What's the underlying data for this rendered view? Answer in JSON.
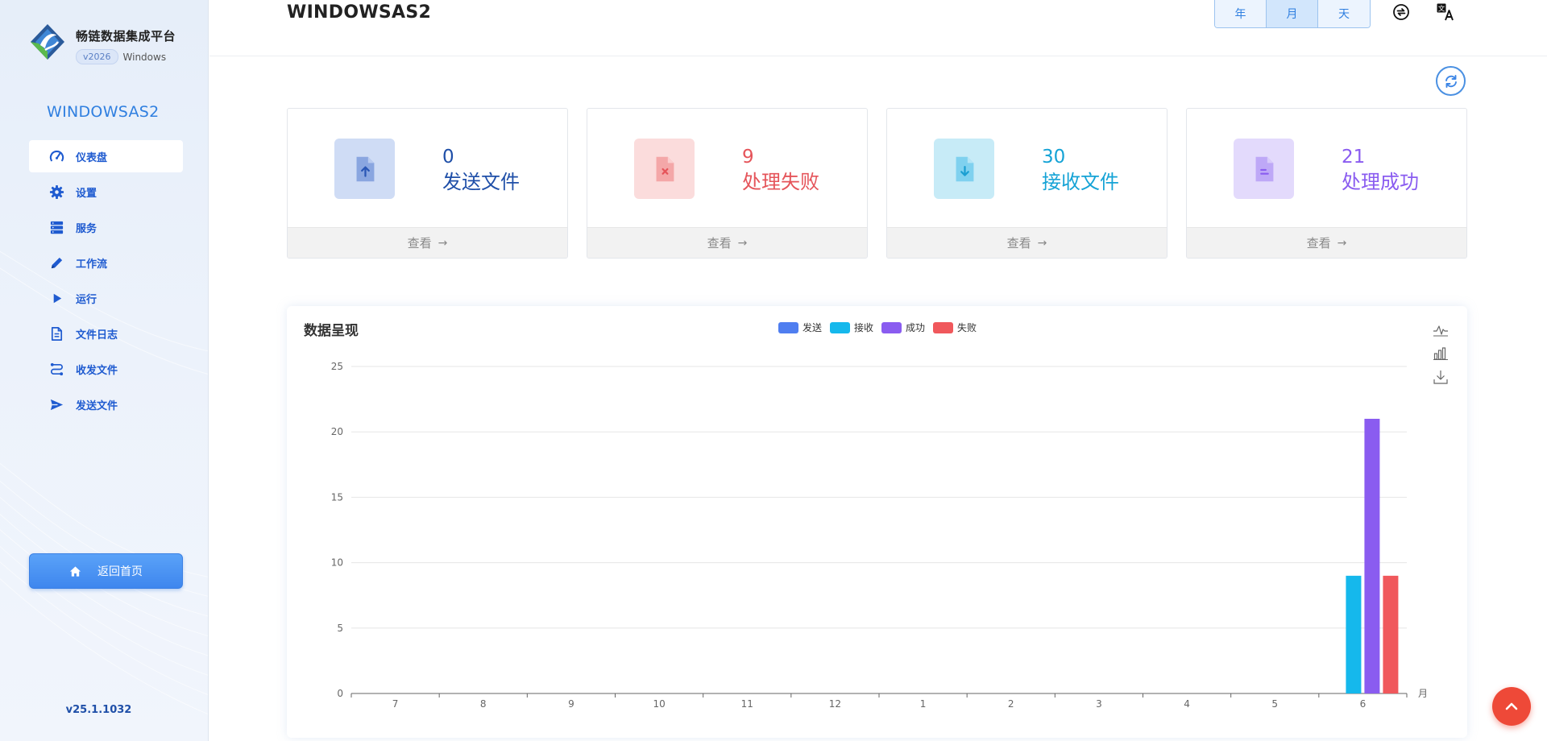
{
  "brand": {
    "name": "畅链数据集成平台",
    "version": "v2026",
    "os": "Windows"
  },
  "sidebar": {
    "title": "WINDOWSAS2",
    "items": [
      {
        "label": "仪表盘",
        "icon": "dashboard-icon",
        "active": true
      },
      {
        "label": "设置",
        "icon": "gear-icon"
      },
      {
        "label": "服务",
        "icon": "server-icon"
      },
      {
        "label": "工作流",
        "icon": "pencil-icon"
      },
      {
        "label": "运行",
        "icon": "play-icon"
      },
      {
        "label": "文件日志",
        "icon": "file-text-icon"
      },
      {
        "label": "收发文件",
        "icon": "route-icon"
      },
      {
        "label": "发送文件",
        "icon": "send-icon"
      }
    ],
    "home_button": "返回首页",
    "version": "v25.1.1032"
  },
  "header": {
    "title": "WINDOWSAS2",
    "periods": [
      "年",
      "月",
      "天"
    ],
    "active_period": "月",
    "icons": [
      "exchange-icon",
      "translate-icon"
    ]
  },
  "stats": [
    {
      "value": "0",
      "label": "发送文件",
      "link": "查看",
      "icon": "file-upload-icon",
      "color": "#1f4fa8",
      "bg": "#cfdcf5",
      "fg": "#8aa6e0",
      "mark": "#2a56b5"
    },
    {
      "value": "9",
      "label": "处理失败",
      "link": "查看",
      "icon": "file-error-icon",
      "color": "#e5545a",
      "bg": "#fbdcdc",
      "fg": "#f4a7a8",
      "mark": "#e5545a"
    },
    {
      "value": "30",
      "label": "接收文件",
      "link": "查看",
      "icon": "file-download-icon",
      "color": "#15a3d6",
      "bg": "#c7ebf7",
      "fg": "#7fd1ef",
      "mark": "#1b9fd2"
    },
    {
      "value": "21",
      "label": "处理成功",
      "link": "查看",
      "icon": "file-done-icon",
      "color": "#8a5cf0",
      "bg": "#e3dafc",
      "fg": "#bea8f7",
      "mark": "#8a5cf0"
    }
  ],
  "chart": {
    "title": "数据呈现",
    "tools": [
      "line-chart-icon",
      "bar-chart-icon",
      "download-icon"
    ]
  },
  "chart_data": {
    "type": "bar",
    "title": "数据呈现",
    "categories": [
      "7",
      "8",
      "9",
      "10",
      "11",
      "12",
      "1",
      "2",
      "3",
      "4",
      "5",
      "6"
    ],
    "xlabel": "月",
    "ylabel": "",
    "ylim": [
      0,
      25
    ],
    "yticks": [
      0,
      5,
      10,
      15,
      20,
      25
    ],
    "grid": true,
    "legend_position": "top-center",
    "series": [
      {
        "name": "发送",
        "color": "#4f7ef0",
        "values": [
          0,
          0,
          0,
          0,
          0,
          0,
          0,
          0,
          0,
          0,
          0,
          0
        ]
      },
      {
        "name": "接收",
        "color": "#15b8ec",
        "values": [
          0,
          0,
          0,
          0,
          0,
          0,
          0,
          0,
          0,
          0,
          0,
          9
        ]
      },
      {
        "name": "成功",
        "color": "#8a5cf0",
        "values": [
          0,
          0,
          0,
          0,
          0,
          0,
          0,
          0,
          0,
          0,
          0,
          21
        ]
      },
      {
        "name": "失败",
        "color": "#f0585c",
        "values": [
          0,
          0,
          0,
          0,
          0,
          0,
          0,
          0,
          0,
          0,
          0,
          9
        ]
      }
    ]
  }
}
